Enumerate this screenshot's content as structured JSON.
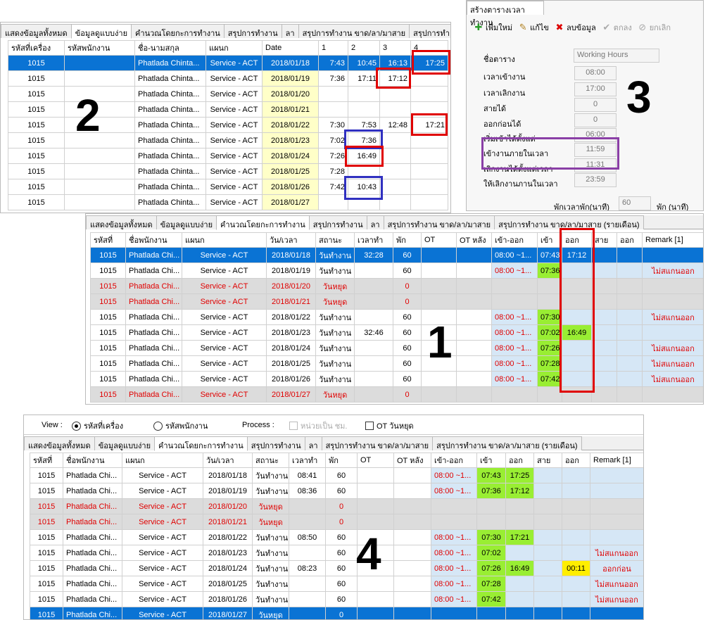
{
  "p2": {
    "tabs": [
      "แสดงข้อมูลทั้งหมด",
      "ข้อมูลดูแบบง่าย",
      "คำนวณโดยกะการทำงาน",
      "สรุปการทำงาน",
      "ลา",
      "สรุปการทำงาน ขาด/ลา/มาสาย",
      "สรุปการทำ"
    ],
    "headers": [
      "รหัสที่เครื่อง",
      "รหัสพนักงาน",
      "ชื่อ-นามสกุล",
      "แผนก",
      "Date",
      "1",
      "2",
      "3",
      "4"
    ],
    "rows": [
      [
        "1015",
        "",
        "Phatlada Chinta...",
        "Service - ACT",
        "2018/01/18",
        "7:43",
        "10:45",
        "16:13",
        "17:25"
      ],
      [
        "1015",
        "",
        "Phatlada Chinta...",
        "Service - ACT",
        "2018/01/19",
        "7:36",
        "17:11",
        "17:12",
        ""
      ],
      [
        "1015",
        "",
        "Phatlada Chinta...",
        "Service - ACT",
        "2018/01/20",
        "",
        "",
        "",
        ""
      ],
      [
        "1015",
        "",
        "Phatlada Chinta...",
        "Service - ACT",
        "2018/01/21",
        "",
        "",
        "",
        ""
      ],
      [
        "1015",
        "",
        "Phatlada Chinta...",
        "Service - ACT",
        "2018/01/22",
        "7:30",
        "7:53",
        "12:48",
        "17:21"
      ],
      [
        "1015",
        "",
        "Phatlada Chinta...",
        "Service - ACT",
        "2018/01/23",
        "7:02",
        "7:36",
        "",
        ""
      ],
      [
        "1015",
        "",
        "Phatlada Chinta...",
        "Service - ACT",
        "2018/01/24",
        "7:26",
        "16:49",
        "",
        ""
      ],
      [
        "1015",
        "",
        "Phatlada Chinta...",
        "Service - ACT",
        "2018/01/25",
        "7:28",
        "",
        "",
        ""
      ],
      [
        "1015",
        "",
        "Phatlada Chinta...",
        "Service - ACT",
        "2018/01/26",
        "7:42",
        "10:43",
        "",
        ""
      ],
      [
        "1015",
        "",
        "Phatlada Chinta...",
        "Service - ACT",
        "2018/01/27",
        "",
        "",
        "",
        ""
      ]
    ],
    "number": "2"
  },
  "p3": {
    "title": "สร้างตารางเวลาทำงาน",
    "toolbar": {
      "add": "เพิ่มใหม่",
      "edit": "แก้ไข",
      "delete": "ลบข้อมูล",
      "ok": "ตกลง",
      "cancel": "ยกเลิก"
    },
    "fields": [
      {
        "label": "ชื่อตาราง",
        "value": "Working Hours"
      },
      {
        "label": "เวลาเข้างาน",
        "value": "08:00"
      },
      {
        "label": "เวลาเลิกงาน",
        "value": "17:00"
      },
      {
        "label": "สายได้",
        "value": "0"
      },
      {
        "label": "ออกก่อนได้",
        "value": "0"
      },
      {
        "label": "เริ่มเข้าได้ตั้งแต่",
        "value": "06:00"
      },
      {
        "label": "เข้างานภายในเวลา",
        "value": "11:59"
      },
      {
        "label": "เลิกงานได้ตั้งแต่เวลา",
        "value": "11:31"
      },
      {
        "label": "ให้เลิกงานภานในเวลา",
        "value": "23:59"
      }
    ],
    "break_label": "พักเวลาพัก(นาที)",
    "break_value": "60",
    "break_unit": "พัก (นาที)",
    "number": "3"
  },
  "p1": {
    "tabs": [
      "แสดงข้อมูลทั้งหมด",
      "ข้อมูลดูแบบง่าย",
      "คำนวณโดยกะการทำงาน",
      "สรุปการทำงาน",
      "ลา",
      "สรุปการทำงาน ขาด/ลา/มาสาย",
      "สรุปการทำงาน ขาด/ลา/มาสาย (รายเดือน)"
    ],
    "headers": [
      "รหัสที่",
      "ชื่อพนักงาน",
      "แผนก",
      "วัน/เวลา",
      "สถานะ",
      "เวลาทำ",
      "พัก",
      "OT",
      "OT หลัง",
      "เข้า-ออก",
      "เข้า",
      "ออก",
      "สาย",
      "ออก",
      "Remark [1]"
    ],
    "rows": [
      [
        "1015",
        "Phatlada Chi...",
        "Service - ACT",
        "2018/01/18",
        "วันทำงาน",
        "32:28",
        "60",
        "",
        "",
        "08:00 ~1...",
        "07:43",
        "17:12",
        "",
        "",
        ""
      ],
      [
        "1015",
        "Phatlada Chi...",
        "Service - ACT",
        "2018/01/19",
        "วันทำงาน",
        "",
        "60",
        "",
        "",
        "08:00 ~1...",
        "07:36",
        "",
        "",
        "",
        "ไม่สแกนออก"
      ],
      [
        "1015",
        "Phatlada Chi...",
        "Service - ACT",
        "2018/01/20",
        "วันหยุด",
        "",
        "0",
        "",
        "",
        "",
        "",
        "",
        "",
        "",
        ""
      ],
      [
        "1015",
        "Phatlada Chi...",
        "Service - ACT",
        "2018/01/21",
        "วันหยุด",
        "",
        "0",
        "",
        "",
        "",
        "",
        "",
        "",
        "",
        ""
      ],
      [
        "1015",
        "Phatlada Chi...",
        "Service - ACT",
        "2018/01/22",
        "วันทำงาน",
        "",
        "60",
        "",
        "",
        "08:00 ~1...",
        "07:30",
        "",
        "",
        "",
        "ไม่สแกนออก"
      ],
      [
        "1015",
        "Phatlada Chi...",
        "Service - ACT",
        "2018/01/23",
        "วันทำงาน",
        "32:46",
        "60",
        "",
        "",
        "08:00 ~1...",
        "07:02",
        "16:49",
        "",
        "",
        ""
      ],
      [
        "1015",
        "Phatlada Chi...",
        "Service - ACT",
        "2018/01/24",
        "วันทำงาน",
        "",
        "60",
        "",
        "",
        "08:00 ~1...",
        "07:26",
        "",
        "",
        "",
        "ไม่สแกนออก"
      ],
      [
        "1015",
        "Phatlada Chi...",
        "Service - ACT",
        "2018/01/25",
        "วันทำงาน",
        "",
        "60",
        "",
        "",
        "08:00 ~1...",
        "07:28",
        "",
        "",
        "",
        "ไม่สแกนออก"
      ],
      [
        "1015",
        "Phatlada Chi...",
        "Service - ACT",
        "2018/01/26",
        "วันทำงาน",
        "",
        "60",
        "",
        "",
        "08:00 ~1...",
        "07:42",
        "",
        "",
        "",
        "ไม่สแกนออก"
      ],
      [
        "1015",
        "Phatlada Chi...",
        "Service - ACT",
        "2018/01/27",
        "วันหยุด",
        "",
        "0",
        "",
        "",
        "",
        "",
        "",
        "",
        "",
        ""
      ]
    ],
    "number": "1"
  },
  "p4": {
    "view_label": "View :",
    "radio1": "รหัสที่เครื่อง",
    "radio2": "รหัสพนักงาน",
    "process_label": "Process :",
    "check1": "หน่วยเป็น ชม.",
    "check2": "OT วันหยุด",
    "tabs": [
      "แสดงข้อมูลทั้งหมด",
      "ข้อมูลดูแบบง่าย",
      "คำนวณโดยกะการทำงาน",
      "สรุปการทำงาน",
      "ลา",
      "สรุปการทำงาน ขาด/ลา/มาสาย",
      "สรุปการทำงาน ขาด/ลา/มาสาย (รายเดือน)"
    ],
    "headers": [
      "รหัสที่",
      "ชื่อพนักงาน",
      "แผนก",
      "วัน/เวลา",
      "สถานะ",
      "เวลาทำ",
      "พัก",
      "OT",
      "OT หลัง",
      "เข้า-ออก",
      "เข้า",
      "ออก",
      "สาย",
      "ออก",
      "Remark [1]"
    ],
    "rows": [
      [
        "1015",
        "Phatlada Chi...",
        "Service - ACT",
        "2018/01/18",
        "วันทำงาน",
        "08:41",
        "60",
        "",
        "",
        "08:00 ~1...",
        "07:43",
        "17:25",
        "",
        "",
        ""
      ],
      [
        "1015",
        "Phatlada Chi...",
        "Service - ACT",
        "2018/01/19",
        "วันทำงาน",
        "08:36",
        "60",
        "",
        "",
        "08:00 ~1...",
        "07:36",
        "17:12",
        "",
        "",
        ""
      ],
      [
        "1015",
        "Phatlada Chi...",
        "Service - ACT",
        "2018/01/20",
        "วันหยุด",
        "",
        "0",
        "",
        "",
        "",
        "",
        "",
        "",
        "",
        ""
      ],
      [
        "1015",
        "Phatlada Chi...",
        "Service - ACT",
        "2018/01/21",
        "วันหยุด",
        "",
        "0",
        "",
        "",
        "",
        "",
        "",
        "",
        "",
        ""
      ],
      [
        "1015",
        "Phatlada Chi...",
        "Service - ACT",
        "2018/01/22",
        "วันทำงาน",
        "08:50",
        "60",
        "",
        "",
        "08:00 ~1...",
        "07:30",
        "17:21",
        "",
        "",
        ""
      ],
      [
        "1015",
        "Phatlada Chi...",
        "Service - ACT",
        "2018/01/23",
        "วันทำงาน",
        "",
        "60",
        "",
        "",
        "08:00 ~1...",
        "07:02",
        "",
        "",
        "",
        "ไม่สแกนออก"
      ],
      [
        "1015",
        "Phatlada Chi...",
        "Service - ACT",
        "2018/01/24",
        "วันทำงาน",
        "08:23",
        "60",
        "",
        "",
        "08:00 ~1...",
        "07:26",
        "16:49",
        "",
        "00:11",
        "ออกก่อน"
      ],
      [
        "1015",
        "Phatlada Chi...",
        "Service - ACT",
        "2018/01/25",
        "วันทำงาน",
        "",
        "60",
        "",
        "",
        "08:00 ~1...",
        "07:28",
        "",
        "",
        "",
        "ไม่สแกนออก"
      ],
      [
        "1015",
        "Phatlada Chi...",
        "Service - ACT",
        "2018/01/26",
        "วันทำงาน",
        "",
        "60",
        "",
        "",
        "08:00 ~1...",
        "07:42",
        "",
        "",
        "",
        "ไม่สแกนออก"
      ],
      [
        "1015",
        "Phatlada Chi...",
        "Service - ACT",
        "2018/01/27",
        "วันหยุด",
        "",
        "0",
        "",
        "",
        "",
        "",
        "",
        "",
        "",
        ""
      ]
    ],
    "number": "4"
  },
  "colors": {
    "selected": "#0a73d4",
    "scan_green": "#99ee33",
    "holiday_bg": "#dcdcdc",
    "date_bg": "#ffffc8",
    "highlight_red": "#e00000",
    "highlight_blue": "#3030c0",
    "highlight_purple": "#8a3fa6"
  }
}
